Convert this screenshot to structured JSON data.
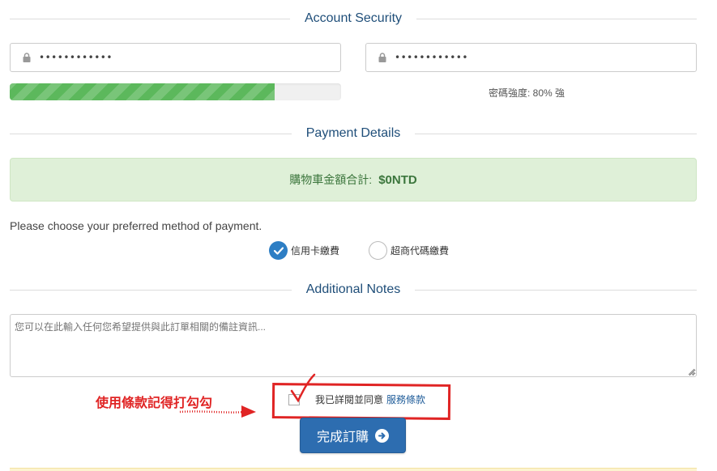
{
  "account_security": {
    "title": "Account Security",
    "password": "••••••••••••",
    "password_confirm": "••••••••••••",
    "strength_percent": 80,
    "strength_text": "密碼強度: 80% 強"
  },
  "payment": {
    "title": "Payment Details",
    "total_label": "購物車金額合計:",
    "total_amount": "$0NTD",
    "prompt": "Please choose your preferred method of payment.",
    "options": [
      {
        "label": "信用卡繳費",
        "selected": true
      },
      {
        "label": "超商代碼繳費",
        "selected": false
      }
    ]
  },
  "notes": {
    "title": "Additional Notes",
    "placeholder": "您可以在此輸入任何您希望提供與此訂單相關的備註資訊..."
  },
  "annotation": {
    "hint": "使用條款記得打勾勾",
    "color": "#e02424"
  },
  "terms": {
    "text": "我已詳閱並同意",
    "link": "服務條款",
    "checked": false
  },
  "submit": {
    "label": "完成訂購",
    "color": "#2d6db0"
  },
  "icons": [
    "lock-icon",
    "check-icon",
    "arrow-right-circle-icon",
    "resize-grip-icon"
  ]
}
